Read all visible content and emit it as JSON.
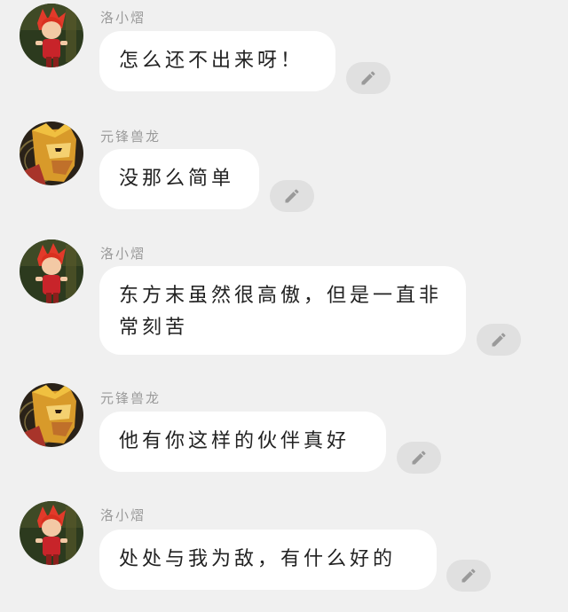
{
  "messages": [
    {
      "sender": "洛小熠",
      "avatar": "red-hair-character-avatar",
      "text": "怎么还不出来呀！"
    },
    {
      "sender": "元锋兽龙",
      "avatar": "golden-dragon-character-avatar",
      "text": "没那么简单"
    },
    {
      "sender": "洛小熠",
      "avatar": "red-hair-character-avatar",
      "text": "东方末虽然很高傲，但是一直非常刻苦"
    },
    {
      "sender": "元锋兽龙",
      "avatar": "golden-dragon-character-avatar",
      "text": "他有你这样的伙伴真好"
    },
    {
      "sender": "洛小熠",
      "avatar": "red-hair-character-avatar",
      "text": "处处与我为敌，有什么好的"
    }
  ],
  "icons": {
    "edit": "pencil-icon"
  },
  "colors": {
    "background": "#f0f0f0",
    "bubble": "#ffffff",
    "edit_button": "#e0e0e0",
    "edit_icon": "#9a9a9a",
    "sender_name": "#9a9a9a"
  }
}
